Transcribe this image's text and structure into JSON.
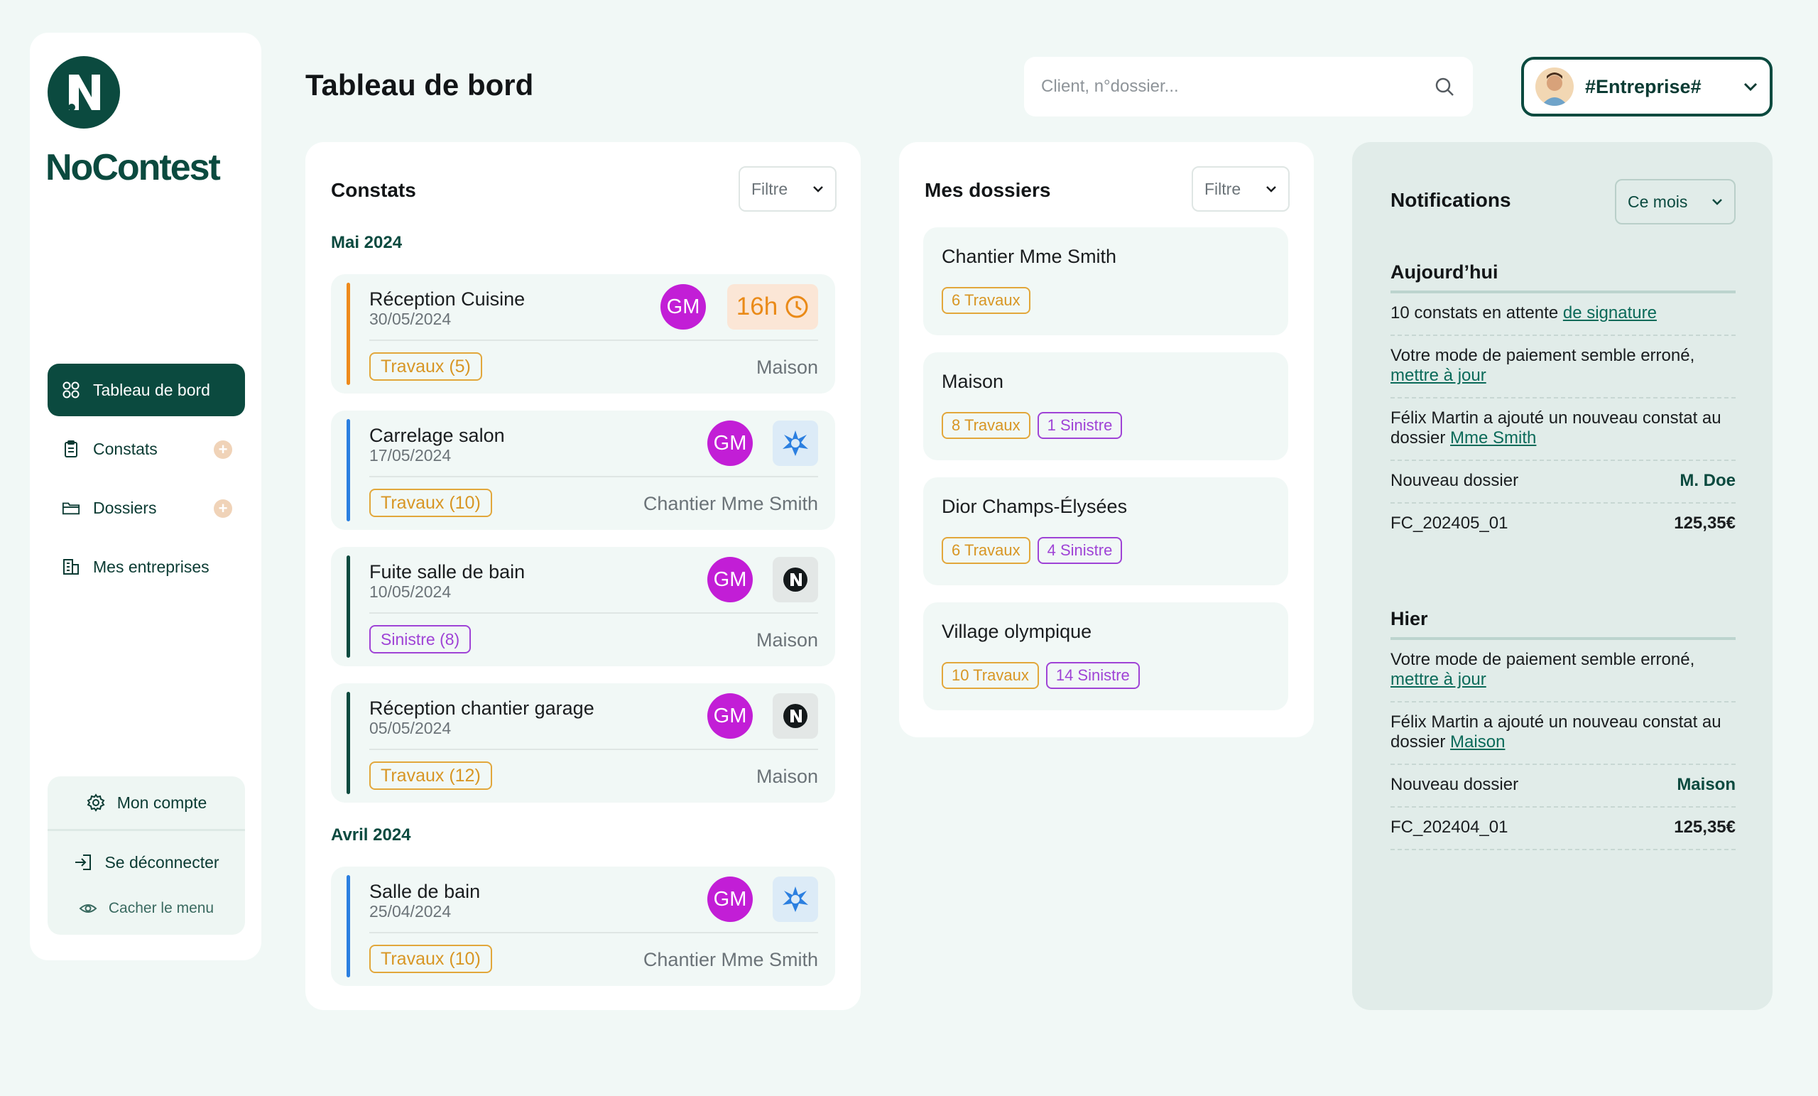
{
  "sidebar": {
    "brand": "NoContest",
    "items": [
      {
        "label": "Tableau de bord",
        "active": true
      },
      {
        "label": "Constats"
      },
      {
        "label": "Dossiers"
      },
      {
        "label": "Mes entreprises"
      }
    ],
    "account": {
      "mon_compte": "Mon compte",
      "logout": "Se déconnecter",
      "hide_menu": "Cacher le menu"
    }
  },
  "header": {
    "title": "Tableau de bord",
    "search_placeholder": "Client, n°dossier...",
    "company": "#Entreprise#"
  },
  "constats": {
    "title": "Constats",
    "filter": "Filtre",
    "groups": [
      {
        "month": "Mai 2024",
        "items": [
          {
            "title": "Réception Cuisine",
            "date": "30/05/2024",
            "initials": "GM",
            "badge": "16h",
            "tag": "Travaux (5)",
            "place": "Maison",
            "bar": "#ee8a1c",
            "tagType": "trav"
          },
          {
            "title": "Carrelage salon",
            "date": "17/05/2024",
            "initials": "GM",
            "tag": "Travaux (10)",
            "place": "Chantier Mme Smith",
            "bar": "#2b7fe0",
            "tagType": "trav"
          },
          {
            "title": "Fuite salle de bain",
            "date": "10/05/2024",
            "initials": "GM",
            "tag": "Sinistre (8)",
            "place": "Maison",
            "bar": "#0b4a3f",
            "tagType": "sin"
          },
          {
            "title": "Réception chantier garage",
            "date": "05/05/2024",
            "initials": "GM",
            "tag": "Travaux (12)",
            "place": "Maison",
            "bar": "#0b4a3f",
            "tagType": "trav"
          }
        ]
      },
      {
        "month": "Avril 2024",
        "items": [
          {
            "title": "Salle de bain",
            "date": "25/04/2024",
            "initials": "GM",
            "tag": "Travaux (10)",
            "place": "Chantier Mme Smith",
            "bar": "#2b7fe0",
            "tagType": "trav"
          }
        ]
      }
    ]
  },
  "dossiers": {
    "title": "Mes dossiers",
    "filter": "Filtre",
    "items": [
      {
        "name": "Chantier Mme Smith",
        "travaux": "6 Travaux"
      },
      {
        "name": "Maison",
        "travaux": "8 Travaux",
        "sinistre": "1 Sinistre"
      },
      {
        "name": "Dior Champs-Élysées",
        "travaux": "6 Travaux",
        "sinistre": "4 Sinistre"
      },
      {
        "name": "Village olympique",
        "travaux": "10 Travaux",
        "sinistre": "14 Sinistre"
      }
    ]
  },
  "notifications": {
    "title": "Notifications",
    "period": "Ce mois",
    "today": {
      "label": "Aujourd’hui",
      "n1_text": "10 constats en attente ",
      "n1_link": "de signature",
      "n2_text": "Votre mode de paiement semble erroné, ",
      "n2_link": "mettre à jour",
      "n3_text": "Félix Martin a ajouté un nouveau constat au dossier ",
      "n3_link": "Mme Smith",
      "n4_label": "Nouveau dossier",
      "n4_value": "M. Doe",
      "n5_label": "FC_202405_01",
      "n5_value": "125,35€"
    },
    "yesterday": {
      "label": "Hier",
      "n1_text": "Votre mode de paiement semble erroné, ",
      "n1_link": "mettre à jour",
      "n2_text": "Félix Martin a ajouté un nouveau constat au dossier ",
      "n2_link": "Maison",
      "n3_label": "Nouveau dossier",
      "n3_value": "Maison",
      "n4_label": "FC_202404_01",
      "n4_value": "125,35€"
    }
  },
  "colors": {
    "brand": "#0b4a3f",
    "travaux": "#d89624",
    "sinistre": "#9f43d6",
    "avatar": "#c21ed6",
    "alert": "#ea8a18"
  }
}
